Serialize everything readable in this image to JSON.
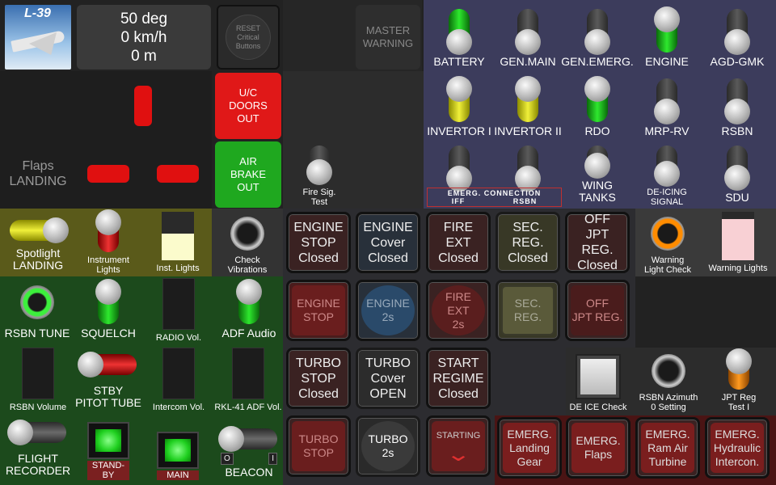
{
  "top": {
    "logo_text": "L-39",
    "readout": {
      "pitch": "50 deg",
      "speed": "0 km/h",
      "alt": "0 m"
    },
    "reset_button": {
      "line1": "RESET",
      "line2": "Critical",
      "line3": "Buttons"
    },
    "master_warning": {
      "line1": "MASTER",
      "line2": "WARNING"
    }
  },
  "flaps": {
    "line1": "Flaps",
    "line2": "LANDING"
  },
  "uc_doors": {
    "line1": "U/C",
    "line2": "DOORS",
    "line3": "OUT"
  },
  "air_brake": {
    "line1": "AIR",
    "line2": "BRAKE",
    "line3": "OUT"
  },
  "fire_sig": {
    "line1": "Fire Sig.",
    "line2": "Test"
  },
  "switches_row1": [
    "BATTERY",
    "GEN.MAIN",
    "GEN.EMERG.",
    "ENGINE",
    "AGD-GMK"
  ],
  "switches_row2": [
    "INVERTOR I",
    "INVERTOR II",
    "RDO",
    "MRP-RV",
    "RSBN"
  ],
  "switches_row3": {
    "emerg_connection": {
      "title": "EMERG. CONNECTION",
      "left": "IFF",
      "right": "RSBN"
    },
    "wing_tanks": "WING TANKS",
    "de_icing": {
      "line1": "DE-ICING",
      "line2": "SIGNAL"
    },
    "sdu": "SDU"
  },
  "left_panel": {
    "spotlight": {
      "line1": "Spotlight",
      "line2": "LANDING"
    },
    "instrument_lights": {
      "line1": "Instrument",
      "line2": "Lights"
    },
    "inst_lights": "Inst. Lights",
    "check_vibrations": {
      "line1": "Check",
      "line2": "Vibrations"
    },
    "rsbn_tune": "RSBN TUNE",
    "squelch": "SQUELCH",
    "radio_vol": "RADIO Vol.",
    "adf_audio": "ADF Audio",
    "rsbn_volume": "RSBN Volume",
    "stby_pitot": {
      "line1": "STBY",
      "line2": "PITOT TUBE"
    },
    "intercom_vol": "Intercom Vol.",
    "rkl_adf_vol": "RKL-41 ADF Vol.",
    "flight_recorder": {
      "line1": "FLIGHT",
      "line2": "RECORDER"
    },
    "stand_by": "STAND-BY",
    "main": "MAIN",
    "beacon": "BEACON",
    "beacon_off": "O",
    "beacon_on": "I"
  },
  "buttons": {
    "engine_stop_closed": {
      "l1": "ENGINE",
      "l2": "STOP",
      "l3": "Closed"
    },
    "engine_cover_closed": {
      "l1": "ENGINE",
      "l2": "Cover",
      "l3": "Closed"
    },
    "fire_ext_closed": {
      "l1": "FIRE",
      "l2": "EXT",
      "l3": "Closed"
    },
    "sec_reg_closed": {
      "l1": "SEC.",
      "l2": "REG.",
      "l3": "Closed"
    },
    "off_jpt_closed": {
      "l1": "OFF",
      "l2": "JPT REG.",
      "l3": "Closed"
    },
    "engine_stop": {
      "l1": "ENGINE",
      "l2": "STOP"
    },
    "engine_2s": {
      "l1": "ENGINE",
      "l2": "2s"
    },
    "fire_ext_2s": {
      "l1": "FIRE",
      "l2": "EXT",
      "l3": "2s"
    },
    "sec_reg": {
      "l1": "SEC.",
      "l2": "REG."
    },
    "off_jpt": {
      "l1": "OFF",
      "l2": "JPT REG."
    },
    "turbo_stop_closed": {
      "l1": "TURBO",
      "l2": "STOP",
      "l3": "Closed"
    },
    "turbo_cover_open": {
      "l1": "TURBO",
      "l2": "Cover",
      "l3": "OPEN"
    },
    "start_regime_closed": {
      "l1": "START",
      "l2": "REGIME",
      "l3": "Closed"
    },
    "turbo_stop": {
      "l1": "TURBO",
      "l2": "STOP"
    },
    "turbo_2s": {
      "l1": "TURBO",
      "l2": "2s"
    },
    "starting": "STARTING",
    "emerg_landing_gear": {
      "l1": "EMERG.",
      "l2": "Landing",
      "l3": "Gear"
    },
    "emerg_flaps": {
      "l1": "EMERG.",
      "l2": "Flaps"
    },
    "emerg_ram_air": {
      "l1": "EMERG.",
      "l2": "Ram Air",
      "l3": "Turbine"
    },
    "emerg_hydraulic": {
      "l1": "EMERG.",
      "l2": "Hydraulic",
      "l3": "Intercon."
    }
  },
  "right_panel": {
    "warning_light_check": {
      "line1": "Warning",
      "line2": "Light Check"
    },
    "warning_lights": "Warning Lights",
    "de_ice_check": "DE ICE Check",
    "rsbn_azimuth": {
      "line1": "RSBN Azimuth",
      "line2": "0 Setting"
    },
    "jpt_reg_test": {
      "line1": "JPT Reg",
      "line2": "Test I"
    }
  },
  "colors": {
    "green": "#2ee82e",
    "red": "#e01010",
    "yellow": "#f0f03a",
    "orange": "#ff8c00",
    "switch_bg": "#3c3c5c"
  }
}
